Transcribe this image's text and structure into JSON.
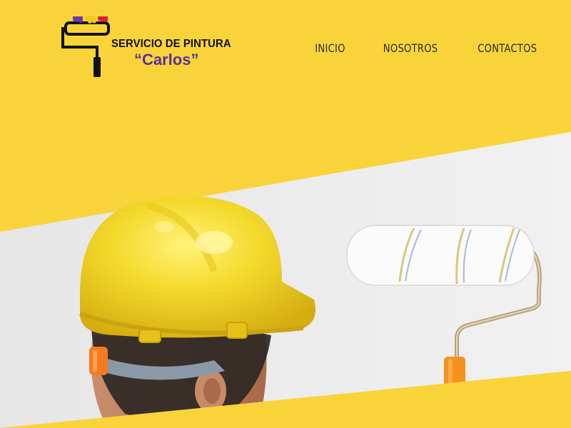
{
  "brand": {
    "line1": "SERVICIO DE PINTURA",
    "line2": "“Carlos”",
    "logo_icon": "paint-roller-icon",
    "logo_colors": [
      "#6b3aa8",
      "#f2c81f",
      "#d8242e"
    ]
  },
  "nav": {
    "items": [
      {
        "label": "INICIO"
      },
      {
        "label": "NOSOTROS"
      },
      {
        "label": "CONTACTOS"
      }
    ]
  },
  "hero": {
    "image": "worker-hard-hat-paint-roller-photo"
  },
  "colors": {
    "background": "#f8d43a",
    "wall": "#eeeeee",
    "helmet": "#f3d52a",
    "brand_purple": "#5b2f99"
  }
}
